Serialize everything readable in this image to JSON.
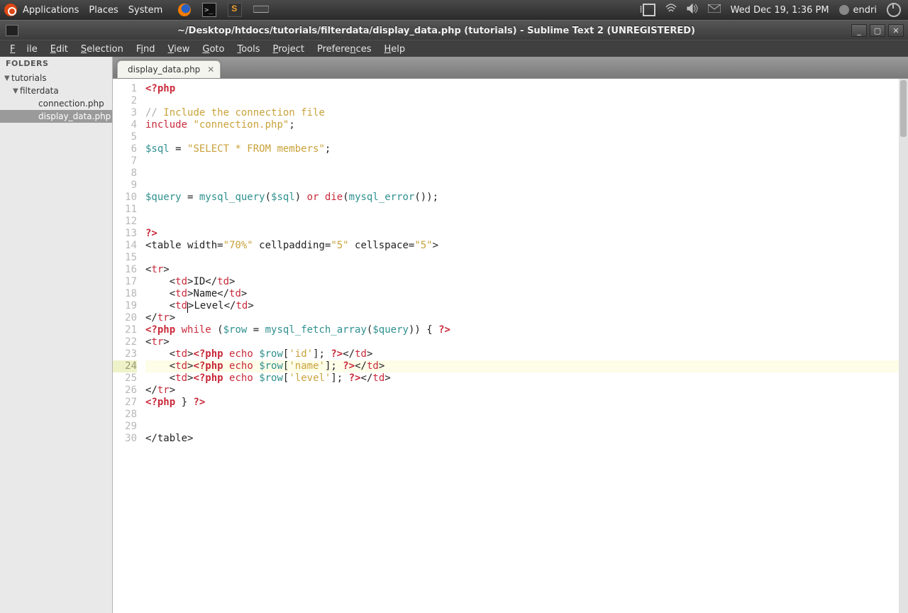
{
  "panel": {
    "menu": [
      "Applications",
      "Places",
      "System"
    ],
    "clock": "Wed Dec 19,  1:36 PM",
    "user": "endri"
  },
  "window": {
    "title": "~/Desktop/htdocs/tutorials/filterdata/display_data.php (tutorials) - Sublime Text 2 (UNREGISTERED)",
    "menubar": [
      "File",
      "Edit",
      "Selection",
      "Find",
      "View",
      "Goto",
      "Tools",
      "Project",
      "Preferences",
      "Help"
    ]
  },
  "sidebar": {
    "header": "FOLDERS",
    "tree": [
      {
        "label": "tutorials",
        "depth": 0,
        "arrow": "▼"
      },
      {
        "label": "filterdata",
        "depth": 1,
        "arrow": "▼"
      },
      {
        "label": "connection.php",
        "depth": 2,
        "arrow": ""
      },
      {
        "label": "display_data.php",
        "depth": 2,
        "arrow": "",
        "selected": true
      }
    ]
  },
  "tabs": [
    {
      "label": "display_data.php"
    }
  ],
  "code": {
    "highlight_line": 24,
    "lines": [
      {
        "n": 1,
        "t": [
          [
            "phptag",
            "<?php"
          ]
        ]
      },
      {
        "n": 2,
        "t": []
      },
      {
        "n": 3,
        "t": [
          [
            "comment",
            "// "
          ],
          [
            "comment-it",
            "Include the connection file"
          ]
        ]
      },
      {
        "n": 4,
        "t": [
          [
            "kw",
            "include"
          ],
          [
            "punc",
            " "
          ],
          [
            "str",
            "\"connection.php\""
          ],
          [
            "punc",
            ";"
          ]
        ]
      },
      {
        "n": 5,
        "t": []
      },
      {
        "n": 6,
        "t": [
          [
            "var",
            "$sql"
          ],
          [
            "punc",
            " = "
          ],
          [
            "str",
            "\"SELECT * FROM members\""
          ],
          [
            "punc",
            ";"
          ]
        ]
      },
      {
        "n": 7,
        "t": []
      },
      {
        "n": 8,
        "t": []
      },
      {
        "n": 9,
        "t": []
      },
      {
        "n": 10,
        "t": [
          [
            "var",
            "$query"
          ],
          [
            "punc",
            " = "
          ],
          [
            "func",
            "mysql_query"
          ],
          [
            "punc",
            "("
          ],
          [
            "var",
            "$sql"
          ],
          [
            "punc",
            ") "
          ],
          [
            "kw",
            "or"
          ],
          [
            "punc",
            " "
          ],
          [
            "kw",
            "die"
          ],
          [
            "punc",
            "("
          ],
          [
            "func",
            "mysql_error"
          ],
          [
            "punc",
            "());"
          ]
        ]
      },
      {
        "n": 11,
        "t": []
      },
      {
        "n": 12,
        "t": []
      },
      {
        "n": 13,
        "t": [
          [
            "phptag",
            "?>"
          ]
        ]
      },
      {
        "n": 14,
        "t": [
          [
            "punc",
            "<table width="
          ],
          [
            "str",
            "\"70%\""
          ],
          [
            "punc",
            " cellpadding="
          ],
          [
            "str",
            "\"5\""
          ],
          [
            "punc",
            " cellspace="
          ],
          [
            "str",
            "\"5\""
          ],
          [
            "punc",
            ">"
          ]
        ]
      },
      {
        "n": 15,
        "t": []
      },
      {
        "n": 16,
        "t": [
          [
            "punc",
            "<"
          ],
          [
            "lit",
            "tr"
          ],
          [
            "punc",
            ">"
          ]
        ]
      },
      {
        "n": 17,
        "t": [
          [
            "punc",
            "    <"
          ],
          [
            "lit",
            "td"
          ],
          [
            "punc",
            ">ID</"
          ],
          [
            "lit",
            "td"
          ],
          [
            "punc",
            ">"
          ]
        ]
      },
      {
        "n": 18,
        "t": [
          [
            "punc",
            "    <"
          ],
          [
            "lit",
            "td"
          ],
          [
            "punc",
            ">Name</"
          ],
          [
            "lit",
            "td"
          ],
          [
            "punc",
            ">"
          ]
        ]
      },
      {
        "n": 19,
        "t": [
          [
            "punc",
            "    <"
          ],
          [
            "lit",
            "td"
          ],
          [
            "cursor",
            ""
          ],
          [
            "punc",
            ">Level</"
          ],
          [
            "lit",
            "td"
          ],
          [
            "punc",
            ">"
          ]
        ]
      },
      {
        "n": 20,
        "t": [
          [
            "punc",
            "</"
          ],
          [
            "lit",
            "tr"
          ],
          [
            "punc",
            ">"
          ]
        ]
      },
      {
        "n": 21,
        "t": [
          [
            "phptag",
            "<?php"
          ],
          [
            "punc",
            " "
          ],
          [
            "kw",
            "while"
          ],
          [
            "punc",
            " ("
          ],
          [
            "var",
            "$row"
          ],
          [
            "punc",
            " = "
          ],
          [
            "func",
            "mysql_fetch_array"
          ],
          [
            "punc",
            "("
          ],
          [
            "var",
            "$query"
          ],
          [
            "punc",
            ")) { "
          ],
          [
            "phptag",
            "?>"
          ]
        ]
      },
      {
        "n": 22,
        "t": [
          [
            "punc",
            "<"
          ],
          [
            "lit",
            "tr"
          ],
          [
            "punc",
            ">"
          ]
        ]
      },
      {
        "n": 23,
        "t": [
          [
            "punc",
            "    <"
          ],
          [
            "lit",
            "td"
          ],
          [
            "punc",
            ">"
          ],
          [
            "phptag",
            "<?php"
          ],
          [
            "punc",
            " "
          ],
          [
            "kw",
            "echo"
          ],
          [
            "punc",
            " "
          ],
          [
            "var",
            "$row"
          ],
          [
            "punc",
            "["
          ],
          [
            "str",
            "'id'"
          ],
          [
            "punc",
            "]; "
          ],
          [
            "phptag",
            "?>"
          ],
          [
            "punc",
            "</"
          ],
          [
            "lit",
            "td"
          ],
          [
            "punc",
            ">"
          ]
        ]
      },
      {
        "n": 24,
        "t": [
          [
            "punc",
            "    <"
          ],
          [
            "lit",
            "td"
          ],
          [
            "punc",
            ">"
          ],
          [
            "phptag",
            "<?php"
          ],
          [
            "punc",
            " "
          ],
          [
            "kw",
            "echo"
          ],
          [
            "punc",
            " "
          ],
          [
            "var",
            "$row"
          ],
          [
            "punc",
            "["
          ],
          [
            "str",
            "'name'"
          ],
          [
            "punc",
            "]; "
          ],
          [
            "phptag",
            "?>"
          ],
          [
            "punc",
            "</"
          ],
          [
            "lit",
            "td"
          ],
          [
            "punc",
            ">"
          ]
        ]
      },
      {
        "n": 25,
        "t": [
          [
            "punc",
            "    <"
          ],
          [
            "lit",
            "td"
          ],
          [
            "punc",
            ">"
          ],
          [
            "phptag",
            "<?php"
          ],
          [
            "punc",
            " "
          ],
          [
            "kw",
            "echo"
          ],
          [
            "punc",
            " "
          ],
          [
            "var",
            "$row"
          ],
          [
            "punc",
            "["
          ],
          [
            "str",
            "'level'"
          ],
          [
            "punc",
            "]; "
          ],
          [
            "phptag",
            "?>"
          ],
          [
            "punc",
            "</"
          ],
          [
            "lit",
            "td"
          ],
          [
            "punc",
            ">"
          ]
        ]
      },
      {
        "n": 26,
        "t": [
          [
            "punc",
            "</"
          ],
          [
            "lit",
            "tr"
          ],
          [
            "punc",
            ">"
          ]
        ]
      },
      {
        "n": 27,
        "t": [
          [
            "phptag",
            "<?php"
          ],
          [
            "punc",
            " } "
          ],
          [
            "phptag",
            "?>"
          ]
        ]
      },
      {
        "n": 28,
        "t": []
      },
      {
        "n": 29,
        "t": []
      },
      {
        "n": 30,
        "t": [
          [
            "punc",
            "</table>"
          ]
        ]
      }
    ]
  }
}
